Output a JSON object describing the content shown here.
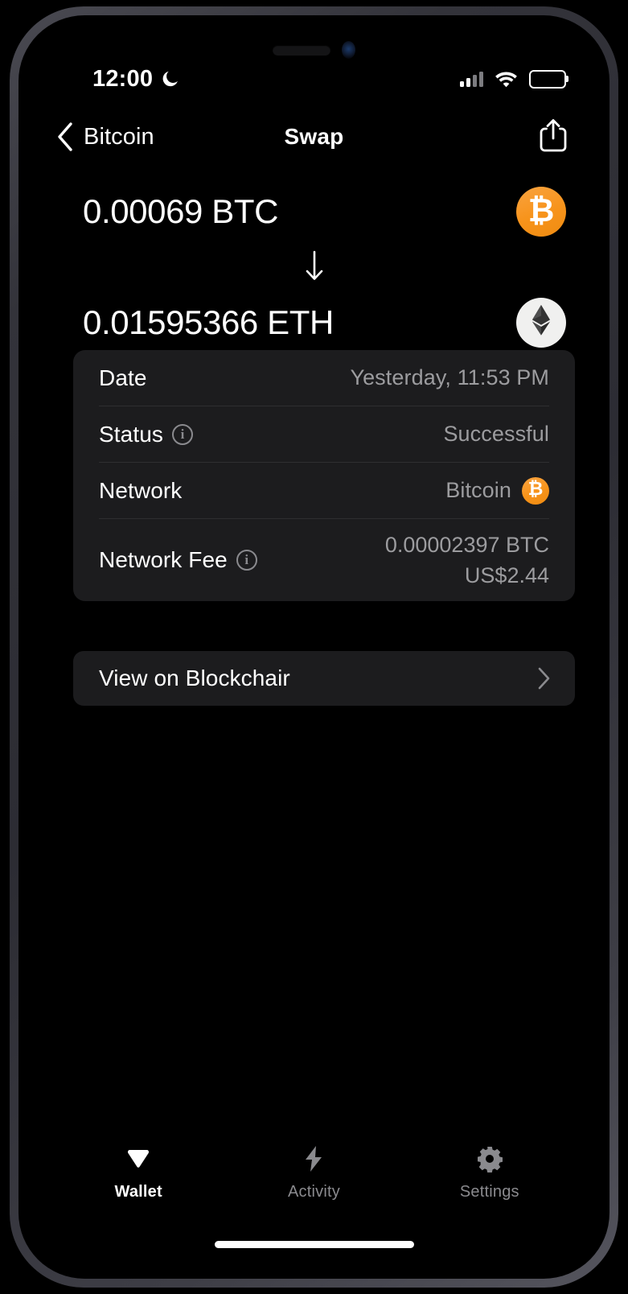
{
  "status_bar": {
    "time": "12:00",
    "moon_icon": "crescent-moon-icon",
    "signal_icon": "cellular-signal-icon",
    "wifi_icon": "wifi-icon",
    "battery_icon": "battery-full-icon"
  },
  "nav": {
    "back_icon": "chevron-left-icon",
    "back_label": "Bitcoin",
    "title": "Swap",
    "share_icon": "share-icon"
  },
  "swap": {
    "from_amount": "0.00069 BTC",
    "from_coin_icon": "bitcoin-coin-icon",
    "arrow_icon": "arrow-down-icon",
    "to_amount": "0.01595366 ETH",
    "to_coin_icon": "ethereum-coin-icon"
  },
  "details": {
    "rows": [
      {
        "label": "Date",
        "value": "Yesterday, 11:53 PM",
        "has_info": false
      },
      {
        "label": "Status",
        "value": "Successful",
        "has_info": true
      },
      {
        "label": "Network",
        "value": "Bitcoin",
        "has_info": false,
        "coin_icon": "bitcoin-coin-icon"
      },
      {
        "label": "Network Fee",
        "value_primary": "0.00002397 BTC",
        "value_secondary": "US$2.44",
        "has_info": true
      }
    ]
  },
  "link_row": {
    "label": "View on Blockchair",
    "chevron_icon": "chevron-right-icon"
  },
  "tabs": [
    {
      "label": "Wallet",
      "icon": "diamond-icon",
      "active": true
    },
    {
      "label": "Activity",
      "icon": "lightning-bolt-icon",
      "active": false
    },
    {
      "label": "Settings",
      "icon": "gear-icon",
      "active": false
    }
  ],
  "colors": {
    "background": "#000000",
    "card": "#1c1c1e",
    "bitcoin_orange": "#f7931a",
    "ethereum_light": "#f0f0ef",
    "secondary_text": "#9c9c9f",
    "divider": "#2e2e30"
  }
}
